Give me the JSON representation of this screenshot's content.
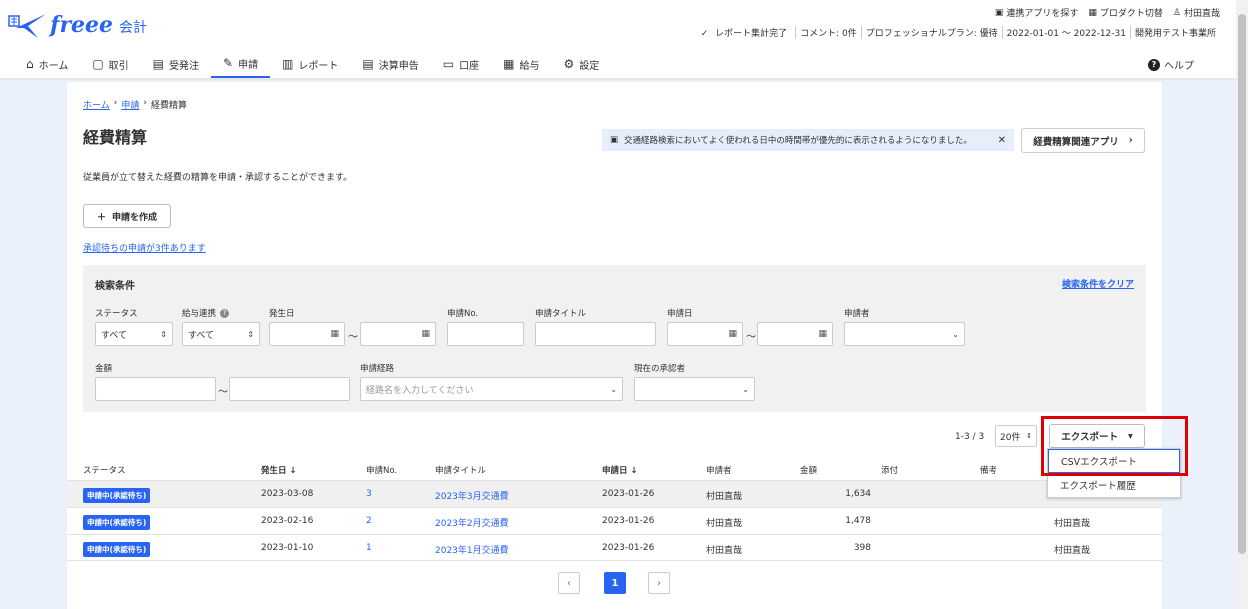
{
  "brand": {
    "logo": "freee",
    "product": "会計",
    "color": "#2864f0"
  },
  "util": {
    "find_apps": "連携アプリを探す",
    "switch_product": "プロダクト切替",
    "user": "村田直哉"
  },
  "status_bar": [
    "レポート集計完了",
    "コメント: 0件",
    "プロフェッショナルプラン: 優待",
    "2022-01-01 ～ 2022-12-31",
    "開発用テスト事業所"
  ],
  "nav": {
    "items": [
      {
        "label": "ホーム",
        "icon": "home-icon"
      },
      {
        "label": "取引",
        "icon": "transaction-icon"
      },
      {
        "label": "受発注",
        "icon": "order-icon"
      },
      {
        "label": "申請",
        "icon": "application-icon"
      },
      {
        "label": "レポート",
        "icon": "report-icon"
      },
      {
        "label": "決算申告",
        "icon": "tax-icon"
      },
      {
        "label": "口座",
        "icon": "account-icon"
      },
      {
        "label": "給与",
        "icon": "payroll-icon"
      },
      {
        "label": "設定",
        "icon": "gear-icon"
      }
    ],
    "active_index": 3,
    "help": "ヘルプ"
  },
  "breadcrumb": {
    "home": "ホーム",
    "apply": "申請",
    "current": "経費精算"
  },
  "page": {
    "title": "経費精算",
    "notice": "交通経路検索においてよく使われる日中の時間帯が優先的に表示されるようになりました。",
    "related_apps": "経費精算関連アプリ",
    "description": "従業員が立て替えた経費の精算を申請・承認することができます。",
    "create_button": "申請を作成",
    "pending_link": "承認待ちの申請が3件あります"
  },
  "search": {
    "heading": "検索条件",
    "clear": "検索条件をクリア",
    "status_label": "ステータス",
    "status_value": "すべて",
    "payroll_label": "給与連携",
    "payroll_value": "すべて",
    "issue_date_label": "発生日",
    "app_no_label": "申請No.",
    "app_title_label": "申請タイトル",
    "app_date_label": "申請日",
    "applicant_label": "申請者",
    "amount_label": "金額",
    "route_label": "申請経路",
    "route_placeholder": "経路名を入力してください",
    "approver_label": "現在の承認者",
    "tilde": "～"
  },
  "list": {
    "range": "1-3 / 3",
    "per_page": "20件",
    "export_button": "エクスポート",
    "export_menu": [
      "CSVエクスポート",
      "エクスポート履歴"
    ],
    "columns": [
      "ステータス",
      "発生日",
      "申請No.",
      "申請タイトル",
      "申請日",
      "申請者",
      "金額",
      "添付",
      "備考"
    ],
    "sort_mark": "↓",
    "rows": [
      {
        "status": "申請中(承認待ち)",
        "date": "2023-03-08",
        "no": "3",
        "title": "2023年3月交通費",
        "app_date": "2023-01-26",
        "applicant": "村田直哉",
        "amount": "1,634",
        "approver": ""
      },
      {
        "status": "申請中(承認待ち)",
        "date": "2023-02-16",
        "no": "2",
        "title": "2023年2月交通費",
        "app_date": "2023-01-26",
        "applicant": "村田直哉",
        "amount": "1,478",
        "approver": "村田直哉"
      },
      {
        "status": "申請中(承認待ち)",
        "date": "2023-01-10",
        "no": "1",
        "title": "2023年1月交通費",
        "app_date": "2023-01-26",
        "applicant": "村田直哉",
        "amount": "398",
        "approver": "村田直哉"
      }
    ],
    "pagination": {
      "prev": "‹",
      "current": "1",
      "next": "›"
    }
  }
}
